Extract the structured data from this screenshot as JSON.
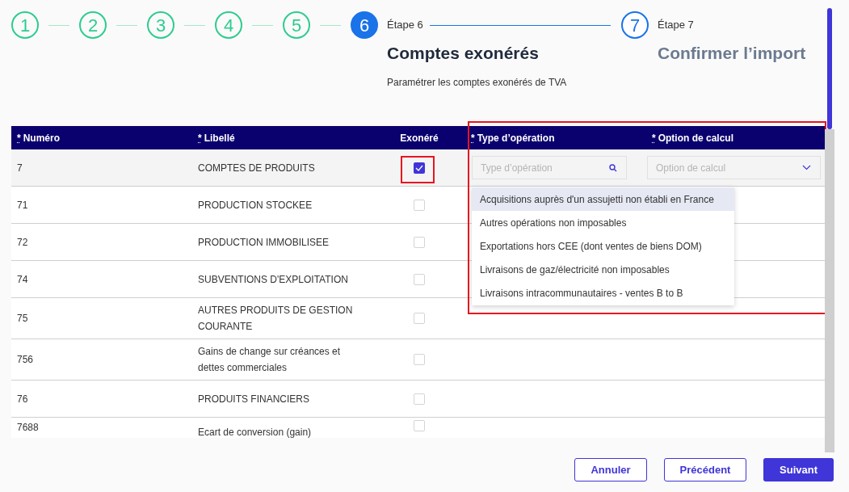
{
  "stepper": [
    {
      "number": "1",
      "completed": true,
      "active": false
    },
    {
      "number": "2",
      "completed": true,
      "active": false
    },
    {
      "number": "3",
      "completed": true,
      "active": false
    },
    {
      "number": "4",
      "completed": true,
      "active": false
    },
    {
      "number": "5",
      "completed": true,
      "active": false
    },
    {
      "number": "6",
      "completed": false,
      "active": true,
      "label": "Étape 6",
      "title": "Comptes exonérés",
      "description": "Paramétrer les comptes exonérés de TVA"
    },
    {
      "number": "7",
      "completed": false,
      "active": false,
      "label": "Étape 7",
      "title": "Confirmer l’import"
    }
  ],
  "table": {
    "columns": [
      {
        "label": "Numéro",
        "required_mark": "*"
      },
      {
        "label": "Libellé",
        "required_mark": "*"
      },
      {
        "label": "Exonéré"
      },
      {
        "label": "Type d’opération",
        "required_mark": "*"
      },
      {
        "label": "Option de calcul",
        "required_mark": "*"
      }
    ],
    "rows": [
      {
        "numero": "7",
        "libelle": "COMPTES DE PRODUITS",
        "exonere": true,
        "type_field": {
          "placeholder": "Type d’opération"
        },
        "option_field": {
          "placeholder": "Option de calcul"
        }
      },
      {
        "numero": "71",
        "libelle": "PRODUCTION STOCKEE",
        "exonere": false
      },
      {
        "numero": "72",
        "libelle": "PRODUCTION IMMOBILISEE",
        "exonere": false
      },
      {
        "numero": "74",
        "libelle": "SUBVENTIONS D'EXPLOITATION",
        "exonere": false
      },
      {
        "numero": "75",
        "libelle": "AUTRES PRODUITS DE GESTION COURANTE",
        "exonere": false
      },
      {
        "numero": "756",
        "libelle": "Gains de change sur créances et dettes commerciales",
        "exonere": false
      },
      {
        "numero": "76",
        "libelle": "PRODUITS FINANCIERS",
        "exonere": false
      },
      {
        "numero": "7688",
        "libelle": "Ecart de conversion (gain)",
        "exonere": false
      }
    ]
  },
  "dropdown": {
    "options": [
      {
        "label": "Acquisitions auprès d'un assujetti non établi en France",
        "selected": true
      },
      {
        "label": "Autres opérations non imposables",
        "selected": false
      },
      {
        "label": "Exportations hors CEE (dont ventes de biens DOM)",
        "selected": false
      },
      {
        "label": "Livraisons de gaz/électricité non imposables",
        "selected": false
      },
      {
        "label": "Livraisons intracommunautaires - ventes B to B",
        "selected": false
      }
    ]
  },
  "buttons": [
    {
      "label": "Annuler",
      "kind": "outline"
    },
    {
      "label": "Précédent",
      "kind": "outline"
    },
    {
      "label": "Suivant",
      "kind": "primary"
    }
  ]
}
